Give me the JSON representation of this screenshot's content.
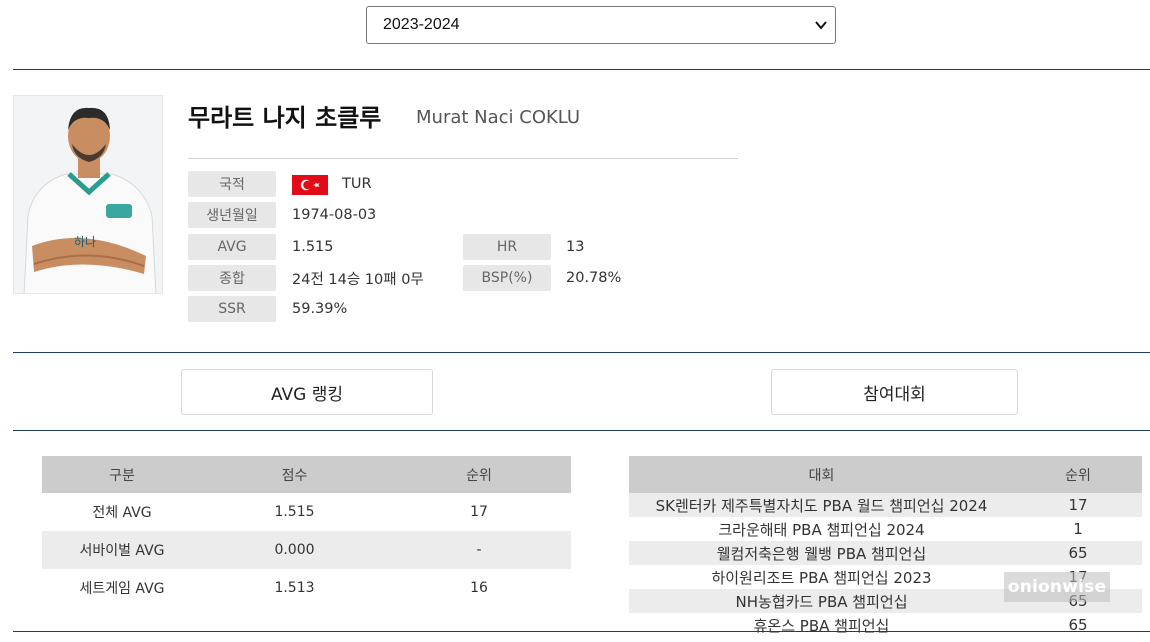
{
  "season_select": {
    "value": "2023-2024"
  },
  "player": {
    "name_ko": "무라트 나지 초클루",
    "name_en": "Murat Naci COKLU",
    "photo_icon": "player-photo"
  },
  "info": {
    "nationality_label": "국적",
    "nationality_value": "TUR",
    "birth_label": "생년월일",
    "birth_value": "1974-08-03",
    "avg_label": "AVG",
    "avg_value": "1.515",
    "hr_label": "HR",
    "hr_value": "13",
    "total_label": "종합",
    "total_value": "24전 14승 10패 0무",
    "bsp_label": "BSP(%)",
    "bsp_value": "20.78%",
    "ssr_label": "SSR",
    "ssr_value": "59.39%"
  },
  "tabs": {
    "avg_ranking": "AVG 랭킹",
    "competitions": "참여대회"
  },
  "avg_table": {
    "headers": [
      "구분",
      "점수",
      "순위"
    ],
    "rows": [
      [
        "전체 AVG",
        "1.515",
        "17"
      ],
      [
        "서바이벌 AVG",
        "0.000",
        "-"
      ],
      [
        "세트게임 AVG",
        "1.513",
        "16"
      ]
    ]
  },
  "comp_table": {
    "headers": [
      "대회",
      "순위"
    ],
    "rows": [
      [
        "SK렌터카 제주특별자치도 PBA 월드 챔피언십 2024",
        "17"
      ],
      [
        "크라운해태 PBA 챔피언십 2024",
        "1"
      ],
      [
        "웰컴저축은행 웰뱅 PBA 챔피언십",
        "65"
      ],
      [
        "하이원리조트 PBA 챔피언십 2023",
        "17"
      ],
      [
        "NH농협카드 PBA 챔피언십",
        "65"
      ],
      [
        "휴온스 PBA 챔피언십",
        "65"
      ]
    ]
  },
  "watermark": "onionwise",
  "colors": {
    "rule": "#1b3f61",
    "flag_red": "#e30a17",
    "header_gray": "#cccccc"
  }
}
